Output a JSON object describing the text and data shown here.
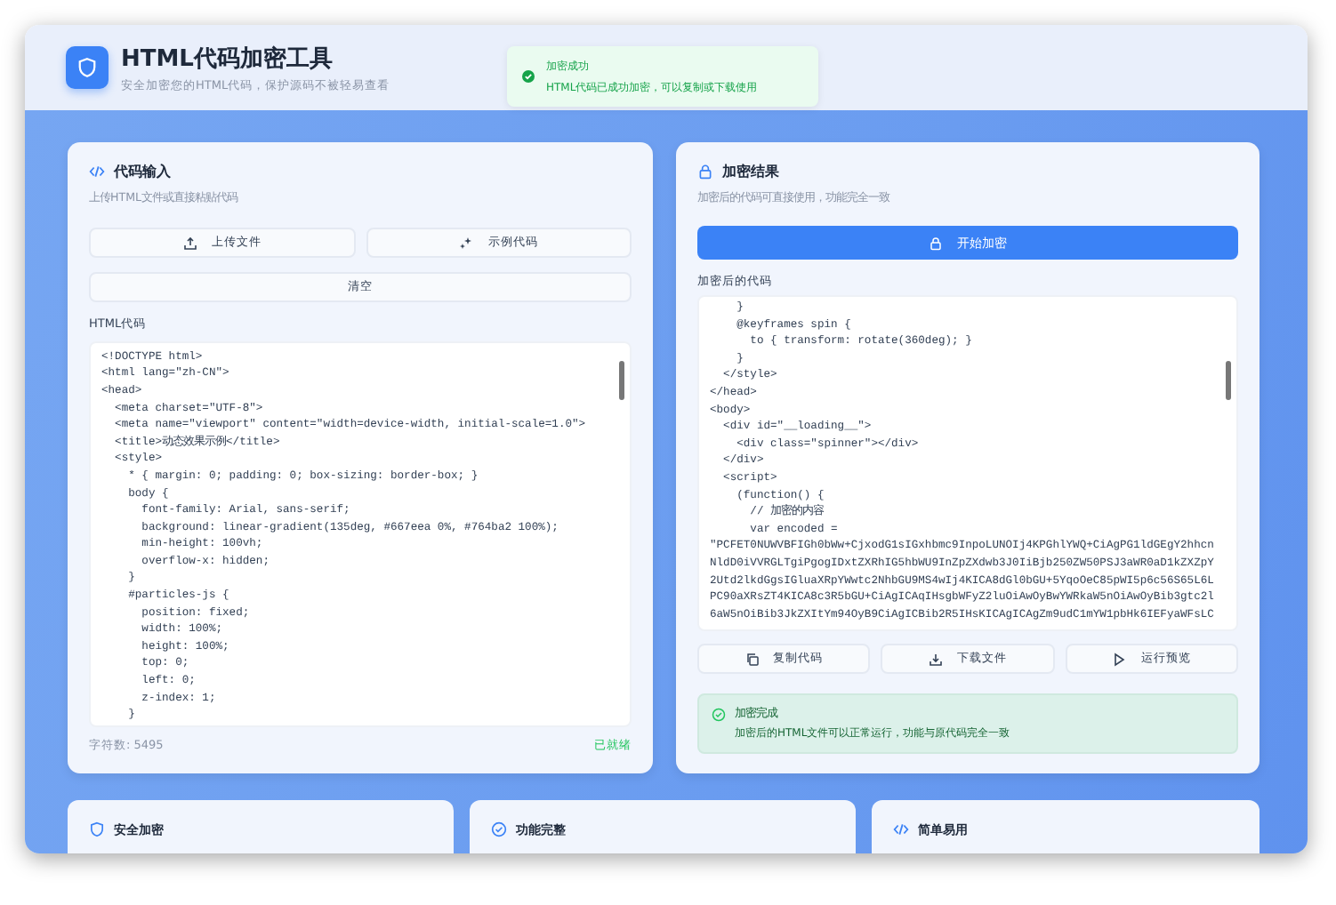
{
  "header": {
    "title": "HTML代码加密工具",
    "subtitle": "安全加密您的HTML代码，保护源码不被轻易查看"
  },
  "toast": {
    "title": "加密成功",
    "message": "HTML代码已成功加密，可以复制或下载使用"
  },
  "input_panel": {
    "title": "代码输入",
    "subtitle": "上传HTML文件或直接粘贴代码",
    "buttons": [
      {
        "label": "上传文件",
        "kind": "upload"
      },
      {
        "label": "示例代码",
        "kind": "sample"
      }
    ],
    "clear_button": "清空",
    "editor_label": "HTML代码",
    "code_lines": [
      "<!DOCTYPE html>",
      "<html lang=\"zh-CN\">",
      "<head>",
      "  <meta charset=\"UTF-8\">",
      "  <meta name=\"viewport\" content=\"width=device-width, initial-scale=1.0\">",
      "  <title>动态效果示例</title>",
      "  <style>",
      "    * { margin: 0; padding: 0; box-sizing: border-box; }",
      "    body {",
      "      font-family: Arial, sans-serif;",
      "      background: linear-gradient(135deg, #667eea 0%, #764ba2 100%);",
      "      min-height: 100vh;",
      "      overflow-x: hidden;",
      "    }",
      "    #particles-js {",
      "      position: fixed;",
      "      width: 100%;",
      "      height: 100%;",
      "      top: 0;",
      "      left: 0;",
      "      z-index: 1;",
      "    }"
    ],
    "char_count": "字符数: 5495",
    "status": "已就绪"
  },
  "output_panel": {
    "title": "加密结果",
    "subtitle": "加密后的代码可直接使用，功能完全一致",
    "encrypt_button": "开始加密",
    "editor_label": "加密后的代码",
    "code_lines": [
      "    }",
      "    @keyframes spin {",
      "      to { transform: rotate(360deg); }",
      "    }",
      "  </style>",
      "</head>",
      "<body>",
      "  <div id=\"__loading__\">",
      "    <div class=\"spinner\"></div>",
      "  </div>",
      "  <script>",
      "    (function() {",
      "      // 加密的内容",
      "      var encoded =",
      "\"PCFET0NUWVBFIGh0bWw+CjxodG1sIGxhbmc9InpoLUNOIj4KPGhlYWQ+CiAgPG1ldGEgY2hhcn",
      "NldD0iVVRGLTgiPgogIDxtZXRhIG5hbWU9InZpZXdwb3J0IiBjb250ZW50PSJ3aWR0aD1kZXZpY",
      "2Utd2lkdGgsIGluaXRpYWwtc2NhbGU9MS4wIj4KICA8dGl0bGU+5YqoOeC85pWI5p6c56S65L6L",
      "PC90aXRsZT4KICA8c3R5bGU+CiAgICAqIHsgbWFyZ2luOiAwOyBwYWRkaW5nOiAwOyBib3gtc2l",
      "6aW5nOiBib3JkZXItYm94OyB9CiAgICBib2R5IHsKICAgICAgZm9udC1mYW1pbHk6IEFyaWFsLC"
    ],
    "actions": [
      {
        "label": "复制代码",
        "kind": "copy"
      },
      {
        "label": "下载文件",
        "kind": "download"
      },
      {
        "label": "运行预览",
        "kind": "play"
      }
    ],
    "notice": {
      "title": "加密完成",
      "message": "加密后的HTML文件可以正常运行，功能与原代码完全一致"
    }
  },
  "features": [
    {
      "title": "安全加密",
      "kind": "shield"
    },
    {
      "title": "功能完整",
      "kind": "check"
    },
    {
      "title": "简单易用",
      "kind": "code"
    }
  ]
}
